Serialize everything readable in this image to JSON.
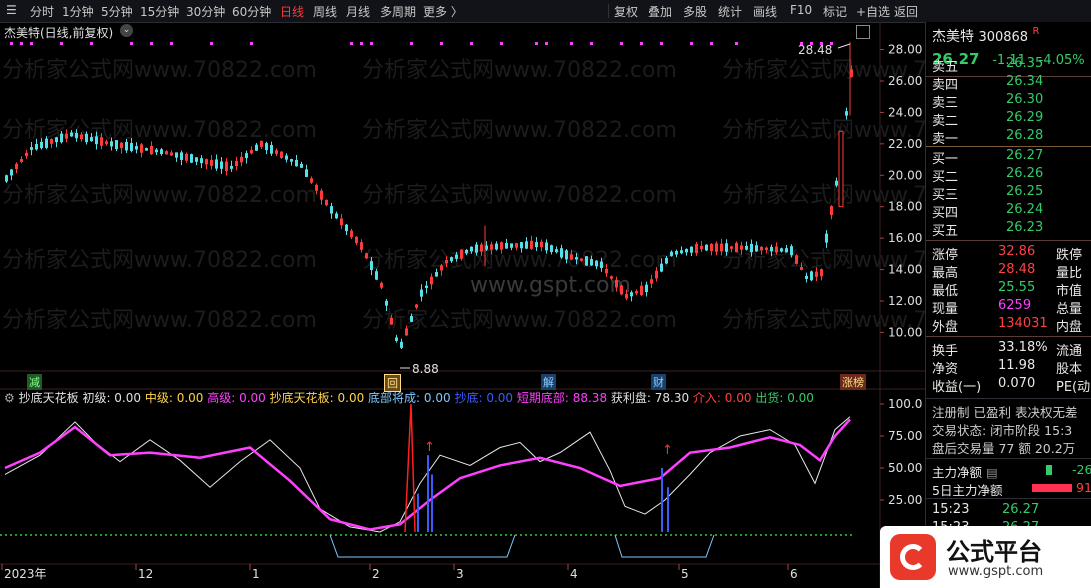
{
  "toolbar": {
    "periods": [
      "分时",
      "1分钟",
      "5分钟",
      "15分钟",
      "30分钟",
      "60分钟",
      "日线",
      "周线",
      "月线",
      "多周期",
      "更多 〉"
    ],
    "active_period": "日线",
    "tools": [
      "复权",
      "叠加",
      "多股",
      "统计",
      "画线",
      "F10",
      "标记",
      "+自选",
      "返回"
    ]
  },
  "chart": {
    "title": "杰美特(日线,前复权)",
    "high_label": "28.48",
    "low_label": "8.88",
    "price_axis": [
      "28.00",
      "26.00",
      "24.00",
      "22.00",
      "20.00",
      "18.00",
      "16.00",
      "14.00",
      "12.00",
      "10.00"
    ],
    "watermark": "分析家公式网www.70822.com",
    "watermark2": "www.gspt.com",
    "events": [
      "减",
      "回",
      "解",
      "财",
      "涨榜"
    ],
    "indicator": {
      "name": "抄底天花板",
      "fields": [
        {
          "label": "初级: 0.00",
          "color": "#e0e0e0"
        },
        {
          "label": "中级: 0.00",
          "color": "#ffd24a"
        },
        {
          "label": "高级: 0.00",
          "color": "#ff40ff"
        },
        {
          "label": "抄底天花板: 0.00",
          "color": "#ffd24a"
        },
        {
          "label": "底部将成: 0.00",
          "color": "#7ec8ff"
        },
        {
          "label": "抄底: 0.00",
          "color": "#3a5cff"
        },
        {
          "label": "短期底部: 88.38",
          "color": "#ff40ff"
        },
        {
          "label": "获利盘: 78.30",
          "color": "#e0e0e0"
        },
        {
          "label": "介入: 0.00",
          "color": "#ff4040"
        },
        {
          "label": "出货: 0.00",
          "color": "#33cc66"
        }
      ],
      "axis": [
        "100.0",
        "75.00",
        "50.00",
        "25.00"
      ]
    },
    "time_axis": [
      "2023年",
      "12",
      "1",
      "2",
      "3",
      "4",
      "5",
      "6"
    ]
  },
  "panel": {
    "name": "杰美特",
    "code": "300868",
    "badge": "R",
    "price": "26.27",
    "change": "-1.11",
    "change_pct": "-4.05%",
    "asks": [
      {
        "label": "卖五",
        "price": "26.35"
      },
      {
        "label": "卖四",
        "price": "26.34"
      },
      {
        "label": "卖三",
        "price": "26.30"
      },
      {
        "label": "卖二",
        "price": "26.29"
      },
      {
        "label": "卖一",
        "price": "26.28"
      }
    ],
    "bids": [
      {
        "label": "买一",
        "price": "26.27"
      },
      {
        "label": "买二",
        "price": "26.26"
      },
      {
        "label": "买三",
        "price": "26.25"
      },
      {
        "label": "买四",
        "price": "26.24"
      },
      {
        "label": "买五",
        "price": "26.23"
      }
    ],
    "stats": [
      {
        "label": "涨停",
        "value": "32.86",
        "color": "#ff4040",
        "label2": "跌停"
      },
      {
        "label": "最高",
        "value": "28.48",
        "color": "#ff4040",
        "label2": "量比"
      },
      {
        "label": "最低",
        "value": "25.55",
        "color": "#33cc66",
        "label2": "市值"
      },
      {
        "label": "现量",
        "value": "6259",
        "color": "#ff40ff",
        "label2": "总量"
      },
      {
        "label": "外盘",
        "value": "134031",
        "color": "#ff4040",
        "label2": "内盘"
      }
    ],
    "stats2": [
      {
        "label": "换手",
        "value": "33.18%",
        "color": "#e8e8e8",
        "label2": "流通"
      },
      {
        "label": "净资",
        "value": "11.98",
        "color": "#e8e8e8",
        "label2": "股本"
      },
      {
        "label": "收益(一)",
        "value": "0.070",
        "color": "#e8e8e8",
        "label2": "PE(动"
      }
    ],
    "info1": "注册制 已盈利 表决权无差",
    "info2": "交易状态: 闭市阶段 15:3",
    "info3": "盘后交易量 77 额 20.2万",
    "flow1_label": "主力净额",
    "flow1_value": "-26",
    "flow2_label": "5日主力净额",
    "flow2_value": "91",
    "ticks": [
      {
        "time": "15:23",
        "price": "26.27"
      },
      {
        "time": "15:23",
        "price": "26.27"
      }
    ]
  },
  "brand": {
    "name": "公式平台",
    "url": "www.gspt.com"
  },
  "colors": {
    "up": "#ff3a3a",
    "down": "#54e0e8",
    "bg": "#000000",
    "accent": "#ff40ff"
  }
}
